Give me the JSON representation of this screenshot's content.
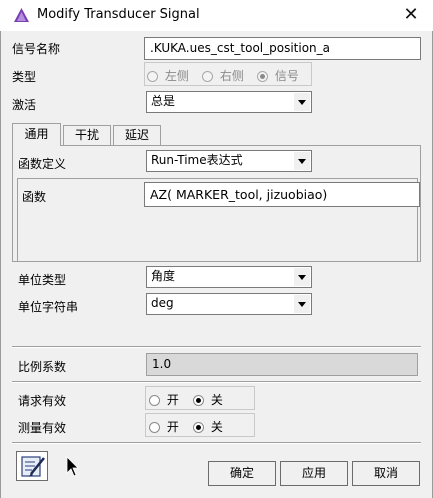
{
  "window": {
    "title": "Modify Transducer Signal",
    "close_glyph": "✕"
  },
  "form": {
    "signal_name_label": "信号名称",
    "signal_name_value": ".KUKA.ues_cst_tool_position_a",
    "type_label": "类型",
    "type_options": [
      "左侧",
      "右侧",
      "信号"
    ],
    "type_selected": "信号",
    "activate_label": "激活",
    "activate_value": "总是"
  },
  "tabs": [
    {
      "label": "通用",
      "active": true
    },
    {
      "label": "干扰",
      "active": false
    },
    {
      "label": "延迟",
      "active": false
    }
  ],
  "general": {
    "function_def_label": "函数定义",
    "function_def_value": "Run-Time表达式",
    "function_label": "函数",
    "function_value": "AZ( MARKER_tool, jizuobiao)",
    "unit_type_label": "单位类型",
    "unit_type_value": "角度",
    "unit_string_label": "单位字符串",
    "unit_string_value": "deg"
  },
  "scale": {
    "label": "比例系数",
    "value": "1.0"
  },
  "request_valid": {
    "label": "请求有效",
    "on_label": "开",
    "off_label": "关",
    "selected": "关"
  },
  "measure_valid": {
    "label": "测量有效",
    "on_label": "开",
    "off_label": "关",
    "selected": "关"
  },
  "buttons": {
    "ok": "确定",
    "apply": "应用",
    "cancel": "取消"
  },
  "icons": {
    "app": "adams-app-icon",
    "notepad": "edit-notepad-icon",
    "cursor": "mouse-pointer-icon"
  }
}
